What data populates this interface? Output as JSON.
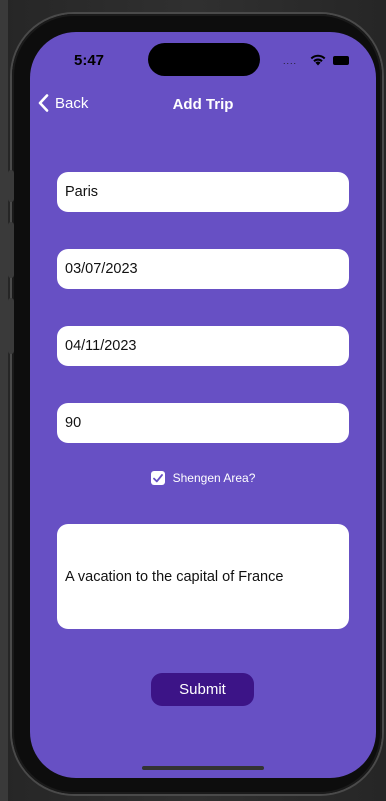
{
  "status_bar": {
    "time": "5:47",
    "signal": "....",
    "icons": [
      "wifi-icon",
      "battery-icon"
    ]
  },
  "nav": {
    "back_label": "Back",
    "title": "Add Trip"
  },
  "form": {
    "destination": "Paris",
    "start_date": "03/07/2023",
    "end_date": "04/11/2023",
    "duration": "90",
    "schengen_label": "Shengen Area?",
    "schengen_checked": true,
    "description": "A vacation to the capital of France",
    "submit_label": "Submit"
  },
  "colors": {
    "background": "#6750c4",
    "submit_button": "#3c1487",
    "field": "#ffffff",
    "text_on_background": "#ffffff"
  }
}
